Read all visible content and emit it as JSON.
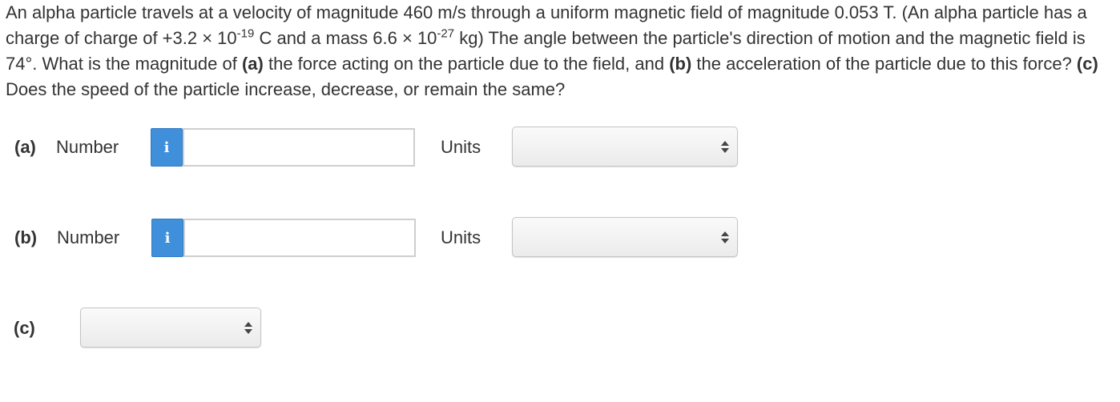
{
  "question": {
    "s1": "An alpha particle travels at a velocity of magnitude 460 m/s through a uniform magnetic field of magnitude 0.053 T. (An alpha particle has a charge of charge of +3.2 × 10",
    "exp1": "-19",
    "s2": " C and a mass 6.6 × 10",
    "exp2": "-27",
    "s3": " kg) The angle between the particle's direction of motion and the magnetic field is 74°. What is the magnitude of ",
    "a_tag": "(a)",
    "s4": " the force acting on the particle due to the field, and ",
    "b_tag": "(b)",
    "s5": " the acceleration of the particle due to this force? ",
    "c_tag": "(c)",
    "s6": " Does the speed of the particle increase, decrease, or remain the same?"
  },
  "part_a": {
    "label": "(a)",
    "number_label": "Number",
    "info_icon": "i",
    "number_value": "",
    "units_label": "Units",
    "units_selected": ""
  },
  "part_b": {
    "label": "(b)",
    "number_label": "Number",
    "info_icon": "i",
    "number_value": "",
    "units_label": "Units",
    "units_selected": ""
  },
  "part_c": {
    "label": "(c)",
    "selected": ""
  },
  "colors": {
    "info_button": "#3f8fdb",
    "text": "#333333",
    "input_border": "#cfcfcf"
  },
  "icons": {
    "info": "info-icon",
    "select_arrows": "updown-arrows-icon"
  }
}
